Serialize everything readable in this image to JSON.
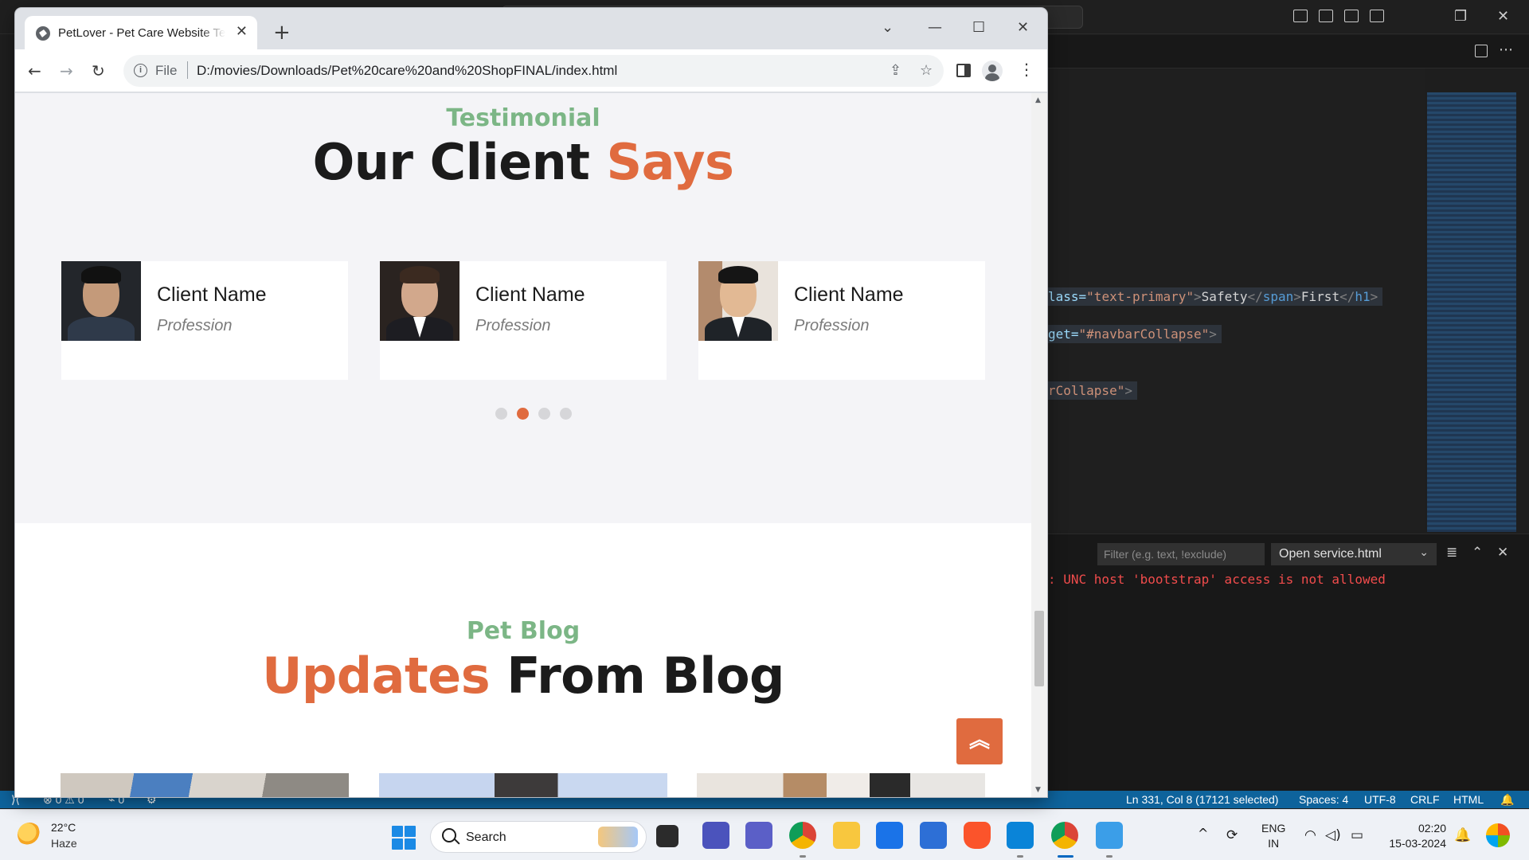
{
  "browser": {
    "tab_title": "PetLover - Pet Care Website Template",
    "scheme_label": "File",
    "url": "D:/movies/Downloads/Pet%20care%20and%20ShopFINAL/index.html"
  },
  "page": {
    "testimonial": {
      "eyebrow": "Testimonial",
      "heading_main": "Our Client ",
      "heading_accent": "Says",
      "cards": [
        {
          "name": "Client Name",
          "profession": "Profession"
        },
        {
          "name": "Client Name",
          "profession": "Profession"
        },
        {
          "name": "Client Name",
          "profession": "Profession"
        }
      ],
      "carousel": {
        "page_count": 4,
        "active_page": 2
      }
    },
    "blog": {
      "eyebrow": "Pet Blog",
      "heading_accent": "Updates",
      "heading_main": " From Blog"
    }
  },
  "editor": {
    "code_lines": [
      {
        "attr": "lass=",
        "value": "\"text-primary\"",
        "text": "Safety",
        "after": "First",
        "close": "h1"
      },
      {
        "attr": "get=",
        "value": "\"#navbarCollapse\""
      },
      {
        "value": "rCollapse\""
      }
    ],
    "panel": {
      "filter_placeholder": "Filter (e.g. text, !exclude)",
      "output_channel": "Open service.html",
      "error_text": ": UNC host 'bootstrap' access is not allowed"
    },
    "status_bar": {
      "errors": "0",
      "warnings": "0",
      "ports": "0",
      "position": "Ln 331, Col 8 (17121 selected)",
      "spaces": "Spaces: 4",
      "encoding": "UTF-8",
      "eol": "CRLF",
      "language": "HTML"
    }
  },
  "taskbar": {
    "weather_temp": "22°C",
    "weather_condition": "Haze",
    "search_label": "Search",
    "lang_line1": "ENG",
    "lang_line2": "IN",
    "time": "02:20",
    "date": "15-03-2024"
  },
  "colors": {
    "accent_orange": "#e06b3f",
    "eyebrow_green": "#7cb686",
    "statusbar_blue": "#0e639c"
  }
}
